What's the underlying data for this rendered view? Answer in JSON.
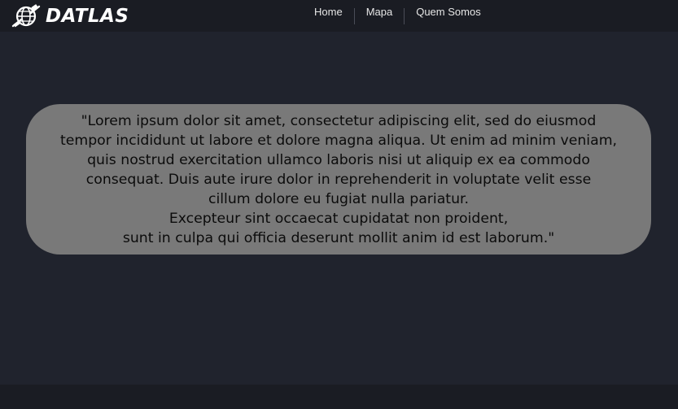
{
  "brand": {
    "logo_icon": "globe-satellite-icon",
    "name": "DATLAS"
  },
  "nav": {
    "items": [
      {
        "label": "Home"
      },
      {
        "label": "Mapa"
      },
      {
        "label": "Quem Somos"
      }
    ]
  },
  "quote": {
    "lines": [
      "\"Lorem ipsum dolor sit amet, consectetur adipiscing elit, sed do eiusmod",
      "tempor incididunt ut labore et dolore magna aliqua. Ut enim ad minim veniam,",
      "quis nostrud exercitation ullamco laboris nisi ut aliquip ex ea commodo",
      "consequat. Duis aute irure dolor in reprehenderit in voluptate velit esse",
      "cillum dolore eu fugiat nulla pariatur.",
      "Excepteur sint occaecat cupidatat non proident,",
      "sunt in culpa qui officia deserunt mollit anim id est laborum.\""
    ]
  },
  "colors": {
    "header_bg": "#1a1c23",
    "page_bg": "#20232d",
    "card_bg": "#797979",
    "nav_text": "#e6e6e6",
    "card_text": "#0b0b0b"
  }
}
